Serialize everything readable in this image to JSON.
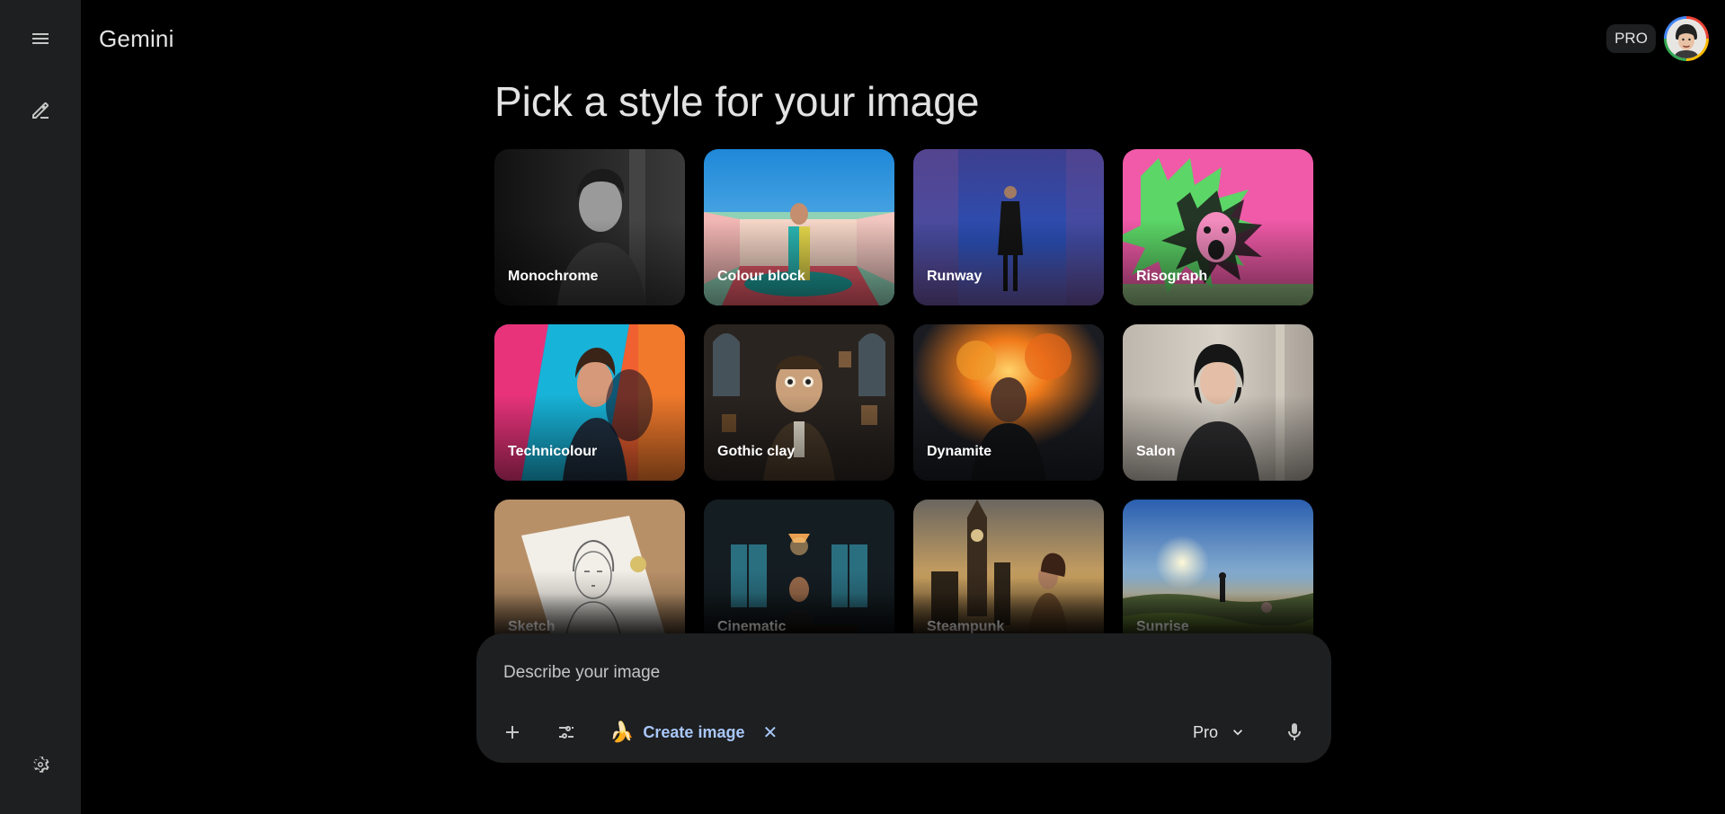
{
  "app": {
    "title": "Gemini",
    "plan_badge": "PRO"
  },
  "page": {
    "title": "Pick a style for your image"
  },
  "styles": [
    {
      "label": "Monochrome"
    },
    {
      "label": "Colour block"
    },
    {
      "label": "Runway"
    },
    {
      "label": "Risograph"
    },
    {
      "label": "Technicolour"
    },
    {
      "label": "Gothic clay"
    },
    {
      "label": "Dynamite"
    },
    {
      "label": "Salon"
    },
    {
      "label": "Sketch"
    },
    {
      "label": "Cinematic"
    },
    {
      "label": "Steampunk"
    },
    {
      "label": "Sunrise"
    }
  ],
  "prompt": {
    "placeholder": "Describe your image",
    "chip_emoji": "🍌",
    "chip_label": "Create image",
    "chip_close": "✕",
    "model": "Pro"
  },
  "icons": {
    "menu": "menu-icon",
    "new_chat": "edit-icon",
    "settings": "gear-icon",
    "add": "plus-icon",
    "tools": "tune-icon",
    "model_dropdown": "chevron-down-icon",
    "mic": "mic-icon"
  },
  "colors": {
    "background": "#000000",
    "surface": "#1e1f20",
    "accent": "#a8c7fa"
  }
}
